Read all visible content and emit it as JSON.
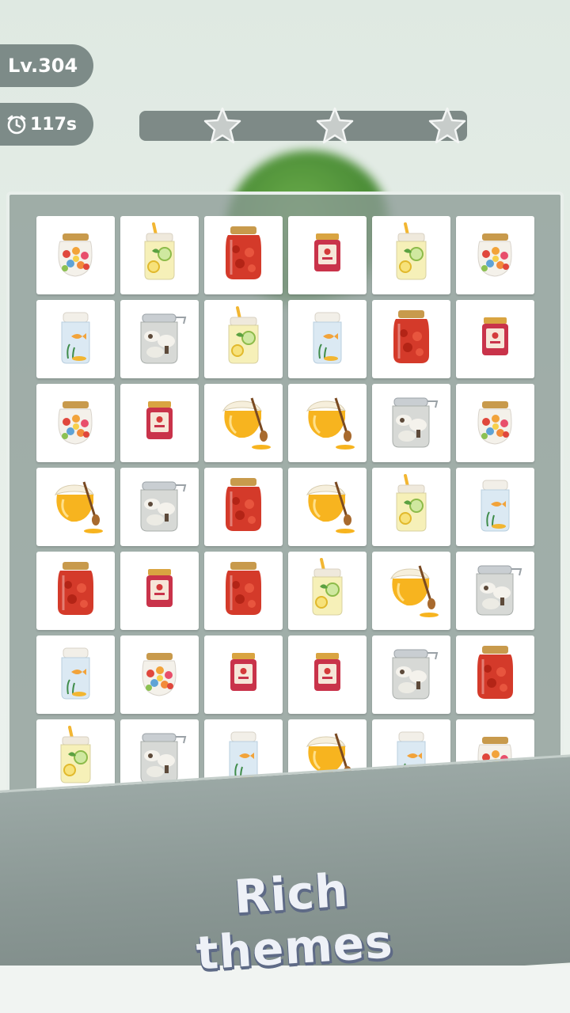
{
  "hud": {
    "level": "Lv.304",
    "timer": "117s",
    "stars_earned": 0,
    "stars_total": 3
  },
  "banner": {
    "text": "Rich themes"
  },
  "board": {
    "rows": 7,
    "cols": 6,
    "tiles": [
      [
        "candy-jar",
        "lemonade-jar",
        "strawberry-jar",
        "jam-jar",
        "lemonade-jar",
        "candy-jar"
      ],
      [
        "fish-jar",
        "mushroom-jar",
        "lemonade-jar",
        "fish-jar",
        "strawberry-jar",
        "jam-jar"
      ],
      [
        "candy-jar",
        "jam-jar",
        "honey-pot",
        "honey-pot",
        "mushroom-jar",
        "candy-jar"
      ],
      [
        "honey-pot",
        "mushroom-jar",
        "strawberry-jar",
        "honey-pot",
        "lemonade-jar",
        "fish-jar"
      ],
      [
        "strawberry-jar",
        "jam-jar",
        "strawberry-jar",
        "lemonade-jar",
        "honey-pot",
        "mushroom-jar"
      ],
      [
        "fish-jar",
        "candy-jar",
        "jam-jar",
        "jam-jar",
        "mushroom-jar",
        "strawberry-jar"
      ],
      [
        "lemonade-jar",
        "mushroom-jar",
        "fish-jar",
        "honey-pot",
        "fish-jar",
        "candy-jar"
      ]
    ]
  },
  "colors": {
    "hud_pill": "#7d8b88",
    "board_bg": "#8c9b96",
    "ribbon": "#8a9794",
    "headline_text": "#eef1f7",
    "headline_shadow": "#5e6a86",
    "star": "#c7ccca"
  }
}
